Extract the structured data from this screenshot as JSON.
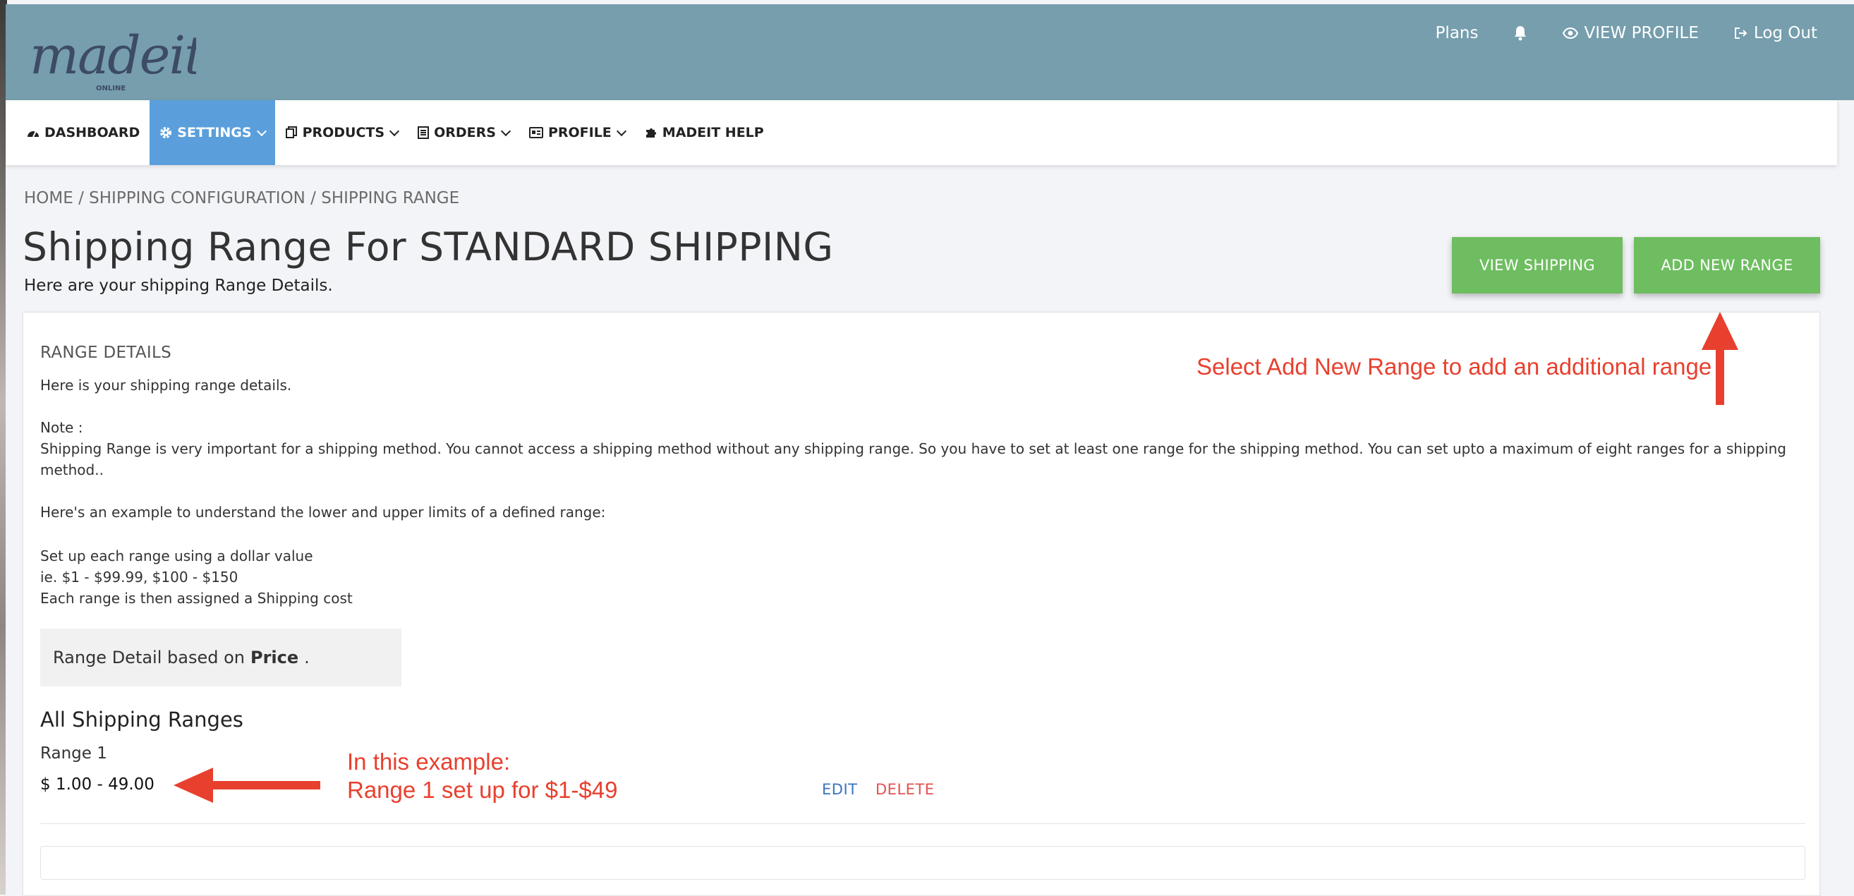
{
  "header": {
    "logo_text": "madeit",
    "logo_sub": "ONLINE",
    "links": {
      "plans": "Plans",
      "view_profile": "VIEW PROFILE",
      "logout": "Log Out"
    }
  },
  "nav": {
    "items": [
      {
        "label": "DASHBOARD",
        "icon": "dashboard-icon"
      },
      {
        "label": "SETTINGS",
        "icon": "gear-icon",
        "active": true
      },
      {
        "label": "PRODUCTS",
        "icon": "products-icon"
      },
      {
        "label": "ORDERS",
        "icon": "orders-icon"
      },
      {
        "label": "PROFILE",
        "icon": "id-card-icon"
      },
      {
        "label": "MADEIT HELP",
        "icon": "puzzle-icon"
      }
    ],
    "active_color": "#5a9fdb"
  },
  "breadcrumb": {
    "home": "HOME",
    "config": "SHIPPING CONFIGURATION",
    "current": "SHIPPING RANGE",
    "separator": " / "
  },
  "page": {
    "title": "Shipping Range For STANDARD SHIPPING",
    "subtitle": "Here are your shipping Range Details."
  },
  "buttons": {
    "view_shipping": "VIEW SHIPPING",
    "add_new_range": "ADD NEW RANGE",
    "color": "#6ebd60"
  },
  "card": {
    "section_title": "RANGE DETAILS",
    "intro": "Here is your shipping range details.",
    "note_label": "Note :",
    "note_line1": "Shipping Range is very important for a shipping method. You cannot access a shipping method without any shipping range. So you have to set at least one range for the shipping method. You can set upto a maximum of eight ranges for a shipping",
    "note_line2": "method..",
    "example_intro": "Here's an example to understand the lower and upper limits of a defined range:",
    "example_line1": "Set up each range using a dollar value",
    "example_line2": "ie. $1 - $99.99, $100 - $150",
    "example_line3": "Each range is then assigned a Shipping cost",
    "range_basis_prefix": "Range Detail based on",
    "range_basis_value": "Price",
    "range_basis_suffix": ".",
    "all_ranges_title": "All Shipping Ranges",
    "ranges": [
      {
        "name": "Range 1",
        "value": "$ 1.00 - 49.00",
        "edit": "EDIT",
        "delete": "DELETE"
      }
    ]
  },
  "annotations": {
    "top": "Select Add New Range to add an additional range",
    "bottom_line1": "In this example:",
    "bottom_line2": "Range 1 set up for $1-$49",
    "color": "#e8402e"
  }
}
